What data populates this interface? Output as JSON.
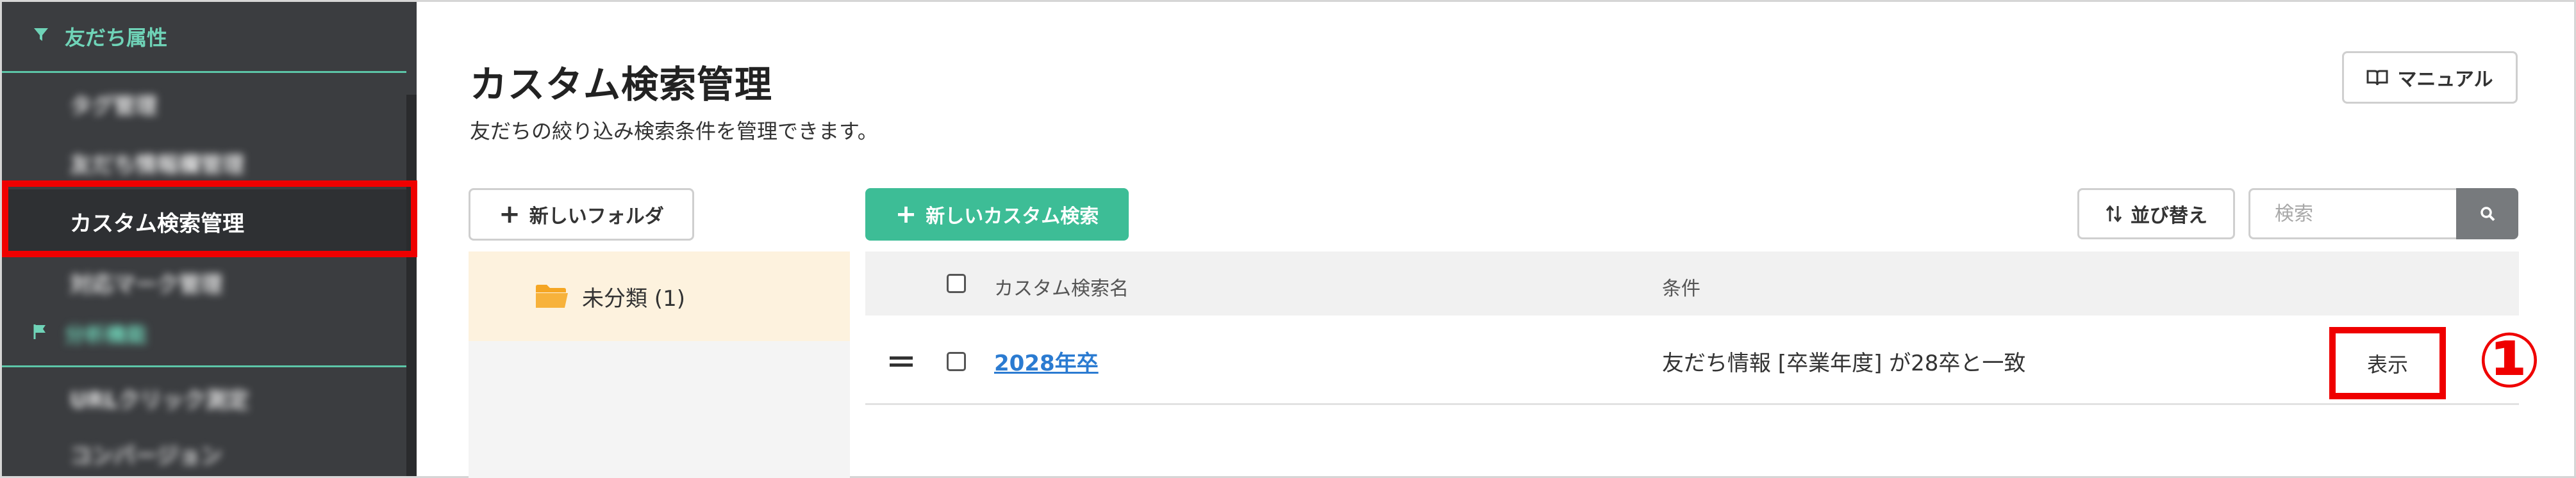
{
  "sidebar": {
    "section_friend_attr": {
      "label": "友だち属性",
      "icon": "filter-icon"
    },
    "items": [
      {
        "label": "タグ管理",
        "blurred": true
      },
      {
        "label": "友だち情報欄管理",
        "blurred": true
      },
      {
        "label": "カスタム検索管理",
        "blurred": false,
        "active": true
      },
      {
        "label": "対応マーク管理",
        "blurred": true
      }
    ],
    "section_second": {
      "label": "分析機能",
      "icon": "flag-icon",
      "blurred": true
    },
    "items_second": [
      {
        "label": "URLクリック測定",
        "blurred": true
      },
      {
        "label": "コンバージョン",
        "blurred": true
      }
    ]
  },
  "header": {
    "title": "カスタム検索管理",
    "subtitle": "友だちの絞り込み検索条件を管理できます。",
    "manual_label": "マニュアル"
  },
  "toolbar": {
    "new_folder_label": "新しいフォルダ",
    "new_search_label": "新しいカスタム検索",
    "sort_label": "並び替え",
    "search_placeholder": "検索"
  },
  "folders": [
    {
      "label": "未分類 (1)"
    }
  ],
  "table": {
    "columns": {
      "name": "カスタム検索名",
      "condition": "条件"
    },
    "rows": [
      {
        "name": "2028年卒",
        "condition": "友だち情報 [卒業年度] が28卒と一致",
        "action_label": "表示"
      }
    ]
  },
  "annotation": {
    "marker": "①"
  },
  "colors": {
    "sidebar_bg": "#3b3d40",
    "accent_green": "#3dbd96",
    "highlight_red": "#ef0000",
    "link_blue": "#2b7bd1",
    "folder_selected_bg": "#fdf2de"
  }
}
